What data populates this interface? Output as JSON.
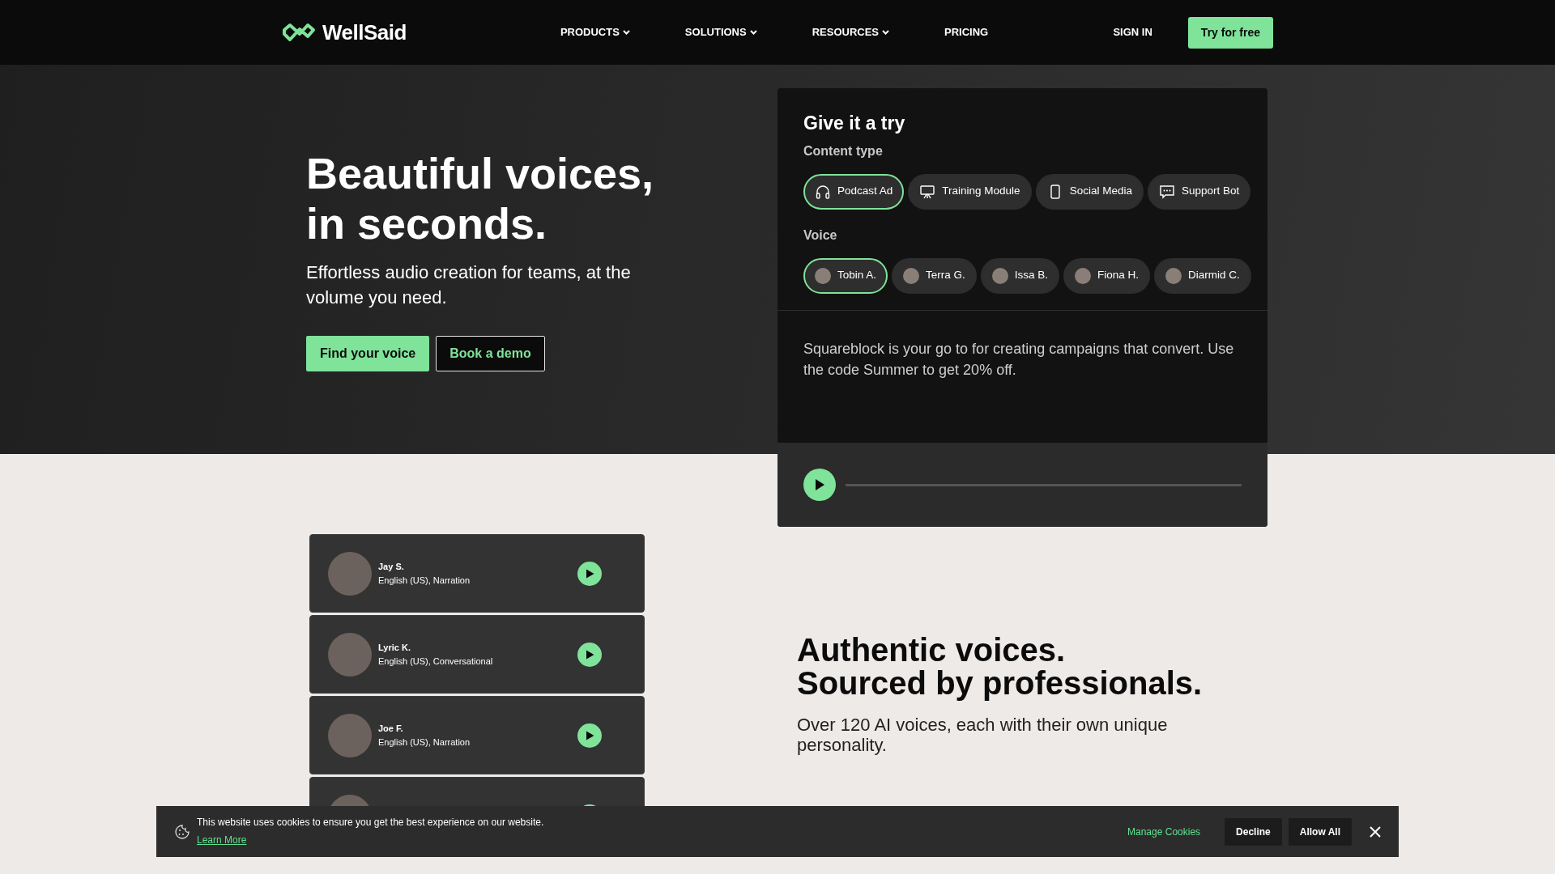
{
  "nav": {
    "logo": "WellSaid",
    "items": [
      {
        "label": "PRODUCTS",
        "dropdown": true
      },
      {
        "label": "SOLUTIONS",
        "dropdown": true
      },
      {
        "label": "RESOURCES",
        "dropdown": true
      },
      {
        "label": "PRICING",
        "dropdown": false
      }
    ],
    "sign_in": "SIGN IN",
    "cta": "Try for free"
  },
  "hero": {
    "title_lines": [
      "Beautiful voices,",
      "in seconds."
    ],
    "subtitle": "Effortless audio creation for teams, at the volume you need.",
    "buttons": [
      {
        "label": "Find your voice",
        "kind": "primary"
      },
      {
        "label": "Book a demo",
        "kind": "outline"
      }
    ]
  },
  "try_panel": {
    "title": "Give it a try",
    "content_type_label": "Content type",
    "content_types": [
      {
        "label": "Podcast Ad",
        "kind": "headphones",
        "selected": true
      },
      {
        "label": "Training Module",
        "kind": "board",
        "selected": false
      },
      {
        "label": "Social Media",
        "kind": "phone",
        "selected": false
      },
      {
        "label": "Support Bot",
        "kind": "chat",
        "selected": false
      }
    ],
    "voice_label": "Voice",
    "voices": [
      {
        "name": "Tobin A.",
        "selected": true
      },
      {
        "name": "Terra G.",
        "selected": false
      },
      {
        "name": "Issa B.",
        "selected": false
      },
      {
        "name": "Fiona H.",
        "selected": false
      },
      {
        "name": "Diarmid C.",
        "selected": false
      }
    ],
    "script": "Squareblock is your go to for creating campaigns that convert. Use the code Summer to get 20% off."
  },
  "voice_cards": [
    {
      "kind": "full",
      "name": "Jay S.",
      "description": "English (US), Narration"
    },
    {
      "kind": "full",
      "name": "Lyric K.",
      "description": "English (US), Conversational"
    },
    {
      "kind": "full",
      "name": "Joe F.",
      "description": "English (US), Narration"
    },
    {
      "kind": "partial"
    }
  ],
  "feature": {
    "title_lines": [
      "Authentic voices.",
      "Sourced by professionals."
    ],
    "text": "Over 120 AI voices, each with their own unique personality."
  },
  "cookie_bar": {
    "message": "This website uses cookies to ensure you get the best experience on our website.",
    "learn_more": "Learn More",
    "manage": "Manage Cookies",
    "decline": "Decline",
    "allow": "Allow All"
  }
}
